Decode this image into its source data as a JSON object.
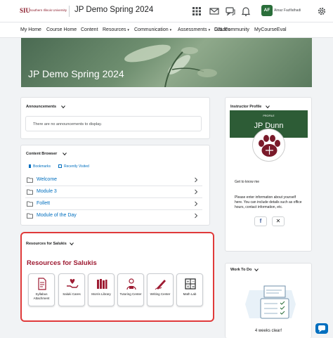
{
  "header": {
    "logo_mark": "SIU",
    "logo_text": "Southern Illinois University",
    "course_title": "JP Demo Spring 2024",
    "avatar_initials": "AF",
    "user_name": "Ainaz Fazlfathadi",
    "icons": [
      "grid-icon",
      "mail-icon",
      "chat-icon",
      "bell-icon",
      "gear-icon"
    ]
  },
  "nav": {
    "items": [
      "My Home",
      "Course Home",
      "Content",
      "Resources",
      "Communication",
      "Assessments",
      "Grades",
      "D2L Community",
      "MyCourseEval"
    ]
  },
  "banner": {
    "title": "JP Demo Spring 2024"
  },
  "announcements": {
    "title": "Announcements",
    "empty_text": "There are no announcements to display."
  },
  "content_browser": {
    "title": "Content Browser",
    "bookmarks": "Bookmarks",
    "recently_visited": "Recently Visited",
    "items": [
      "Welcome",
      "Module 3",
      "Follett",
      "Module of the Day"
    ]
  },
  "resources": {
    "widget_title": "Resources for Salukis",
    "heading": "Resources for Salukis",
    "tiles": [
      {
        "label": "Syllabus Attachment"
      },
      {
        "label": "Saluki Cares"
      },
      {
        "label": "Morris Library"
      },
      {
        "label": "Tutoring Center"
      },
      {
        "label": "Writing Center"
      },
      {
        "label": "Math Lab"
      }
    ]
  },
  "instructor_profile": {
    "title": "Instructor Profile",
    "kicker": "PROFILE",
    "name": "JP Dunn",
    "get_to_know": "Get to know me",
    "info": "Please enter information about yourself here. You can include details such as office hours, contact information, etc.",
    "social": [
      "facebook-icon",
      "x-icon"
    ]
  },
  "work_to_do": {
    "title": "Work To Do",
    "status": "4 weeks clear!"
  },
  "colors": {
    "brand": "#9e1b32",
    "profile_green": "#2d5c36",
    "link": "#006fbf",
    "highlight": "#e03a3a"
  }
}
